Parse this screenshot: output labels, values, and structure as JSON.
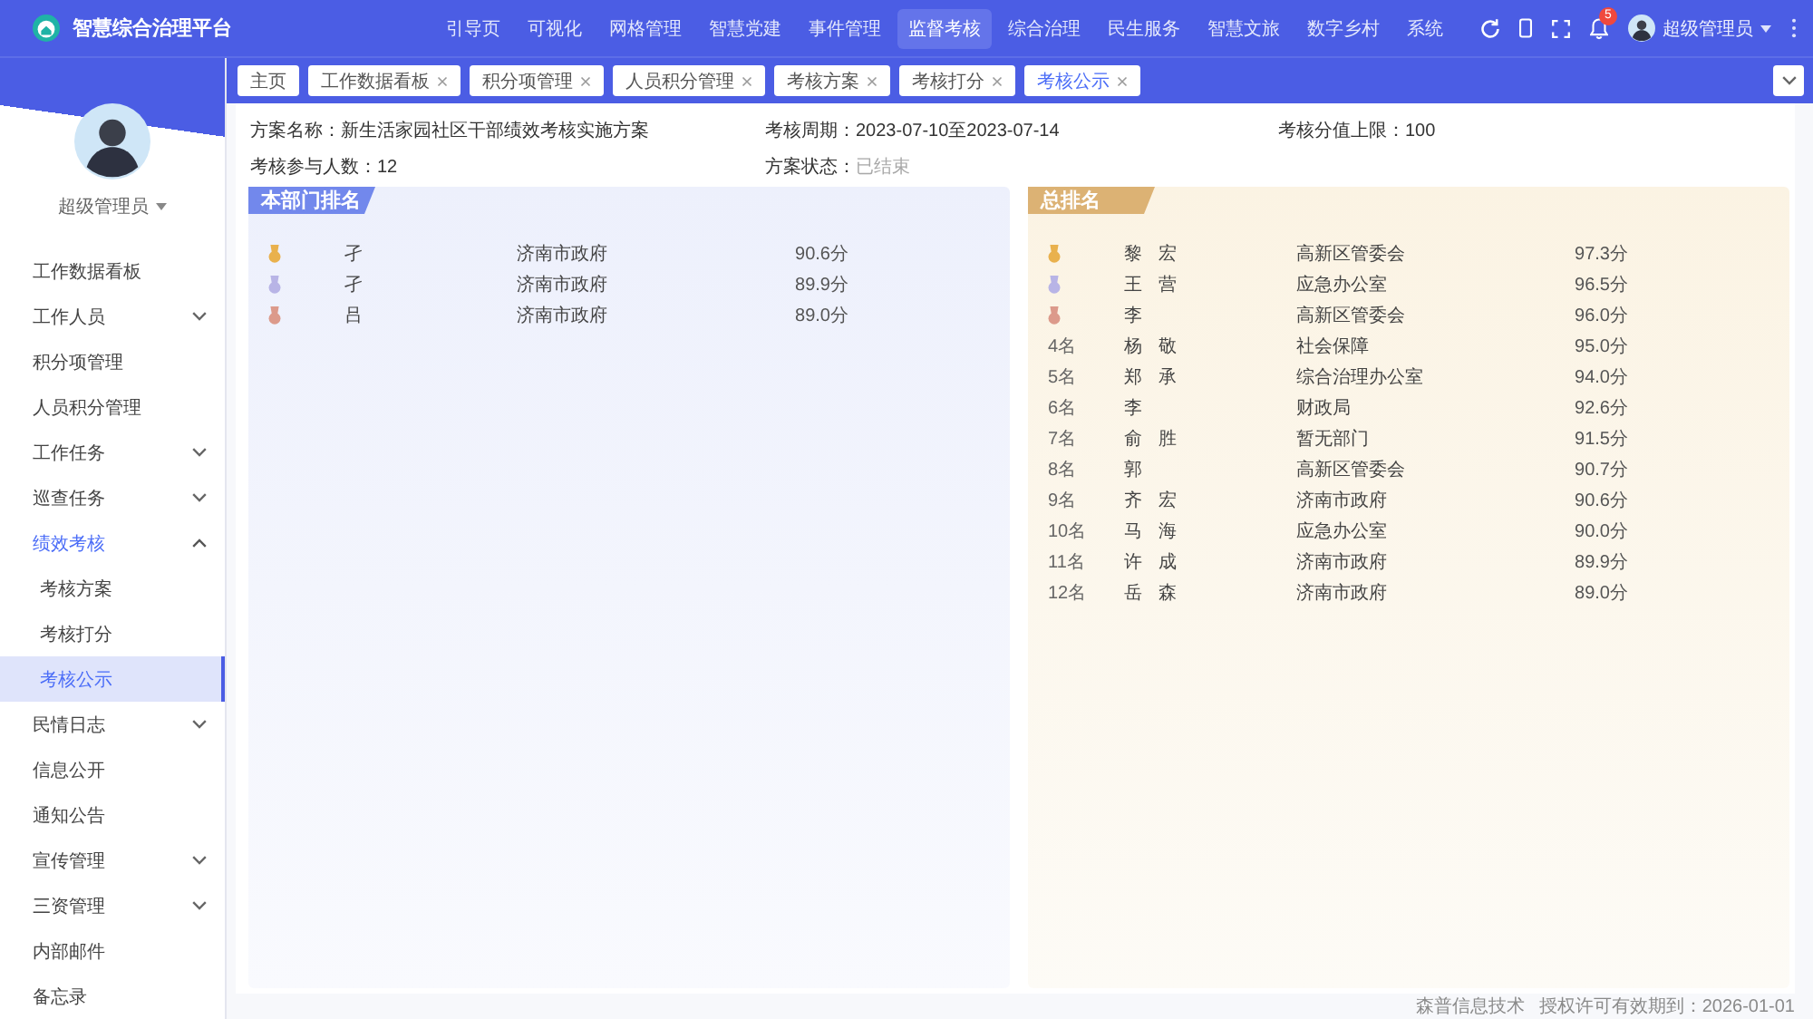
{
  "header": {
    "title": "智慧综合治理平台",
    "nav": [
      {
        "label": "引导页",
        "selected": false
      },
      {
        "label": "可视化",
        "selected": false
      },
      {
        "label": "网格管理",
        "selected": false
      },
      {
        "label": "智慧党建",
        "selected": false
      },
      {
        "label": "事件管理",
        "selected": false
      },
      {
        "label": "监督考核",
        "selected": true
      },
      {
        "label": "综合治理",
        "selected": false
      },
      {
        "label": "民生服务",
        "selected": false
      },
      {
        "label": "智慧文旅",
        "selected": false
      },
      {
        "label": "数字乡村",
        "selected": false
      },
      {
        "label": "系统",
        "selected": false
      }
    ],
    "notification_count": "5",
    "user": "超级管理员"
  },
  "tabs": [
    {
      "label": "主页",
      "closable": false,
      "selected": false
    },
    {
      "label": "工作数据看板",
      "closable": true,
      "selected": false
    },
    {
      "label": "积分项管理",
      "closable": true,
      "selected": false
    },
    {
      "label": "人员积分管理",
      "closable": true,
      "selected": false
    },
    {
      "label": "考核方案",
      "closable": true,
      "selected": false
    },
    {
      "label": "考核打分",
      "closable": true,
      "selected": false
    },
    {
      "label": "考核公示",
      "closable": true,
      "selected": true
    }
  ],
  "sidebar": {
    "user": "超级管理员",
    "items": [
      {
        "kind": "link",
        "label": "工作数据看板",
        "selected": false
      },
      {
        "kind": "group",
        "label": "工作人员",
        "expanded": false
      },
      {
        "kind": "link",
        "label": "积分项管理",
        "selected": false
      },
      {
        "kind": "link",
        "label": "人员积分管理",
        "selected": false
      },
      {
        "kind": "group",
        "label": "工作任务",
        "expanded": false
      },
      {
        "kind": "group",
        "label": "巡查任务",
        "expanded": false
      },
      {
        "kind": "group",
        "label": "绩效考核",
        "expanded": true,
        "children": [
          {
            "label": "考核方案",
            "selected": false
          },
          {
            "label": "考核打分",
            "selected": false
          },
          {
            "label": "考核公示",
            "selected": true
          }
        ]
      },
      {
        "kind": "group",
        "label": "民情日志",
        "expanded": false
      },
      {
        "kind": "link",
        "label": "信息公开",
        "selected": false
      },
      {
        "kind": "link",
        "label": "通知公告",
        "selected": false
      },
      {
        "kind": "group",
        "label": "宣传管理",
        "expanded": false
      },
      {
        "kind": "group",
        "label": "三资管理",
        "expanded": false
      },
      {
        "kind": "link",
        "label": "内部邮件",
        "selected": false
      },
      {
        "kind": "link",
        "label": "备忘录",
        "selected": false
      }
    ]
  },
  "plan": {
    "fields": [
      {
        "kind": "text",
        "label": "方案名称：",
        "value": "新生活家园社区干部绩效考核实施方案"
      },
      {
        "kind": "text",
        "label": "考核周期：",
        "value": "2023-07-10至2023-07-14"
      },
      {
        "kind": "text",
        "label": "考核分值上限：",
        "value": "100"
      },
      {
        "kind": "text",
        "label": "考核参与人数：",
        "value": "12"
      },
      {
        "kind": "status",
        "label": "方案状态：",
        "value": "已结束"
      }
    ]
  },
  "department_ranking": {
    "title": "本部门排名",
    "rows": [
      {
        "kind": "medal",
        "color": "#e9b14d",
        "name": "孑",
        "department": "济南市政府",
        "score": "90.6分"
      },
      {
        "kind": "medal",
        "color": "#b8b4e6",
        "name": "孑",
        "department": "济南市政府",
        "score": "89.9分"
      },
      {
        "kind": "medal",
        "color": "#dc9a8b",
        "name": "吕",
        "department": "济南市政府",
        "score": "89.0分"
      }
    ]
  },
  "overall_ranking": {
    "title": "总排名",
    "rows": [
      {
        "kind": "medal",
        "color": "#e9b14d",
        "name": "黎 宏",
        "department": "高新区管委会",
        "score": "97.3分"
      },
      {
        "kind": "medal",
        "color": "#b8b4e6",
        "name": "王 营",
        "department": "应急办公室",
        "score": "96.5分"
      },
      {
        "kind": "medal",
        "color": "#dc9a8b",
        "name": "李",
        "department": "高新区管委会",
        "score": "96.0分"
      },
      {
        "kind": "rank",
        "rank": "4名",
        "name": "杨 敬",
        "department": "社会保障",
        "score": "95.0分"
      },
      {
        "kind": "rank",
        "rank": "5名",
        "name": "郑 承",
        "department": "综合治理办公室",
        "score": "94.0分"
      },
      {
        "kind": "rank",
        "rank": "6名",
        "name": "李",
        "department": "财政局",
        "score": "92.6分"
      },
      {
        "kind": "rank",
        "rank": "7名",
        "name": "俞 胜",
        "department": "暂无部门",
        "score": "91.5分"
      },
      {
        "kind": "rank",
        "rank": "8名",
        "name": "郭",
        "department": "高新区管委会",
        "score": "90.7分"
      },
      {
        "kind": "rank",
        "rank": "9名",
        "name": "齐 宏",
        "department": "济南市政府",
        "score": "90.6分"
      },
      {
        "kind": "rank",
        "rank": "10名",
        "name": "马 海",
        "department": "应急办公室",
        "score": "90.0分"
      },
      {
        "kind": "rank",
        "rank": "11名",
        "name": "许 成",
        "department": "济南市政府",
        "score": "89.9分"
      },
      {
        "kind": "rank",
        "rank": "12名",
        "name": "岳 森",
        "department": "济南市政府",
        "score": "89.0分"
      }
    ]
  },
  "footer": {
    "company": "森普信息技术",
    "license": "授权许可有效期到：2026-01-01"
  }
}
